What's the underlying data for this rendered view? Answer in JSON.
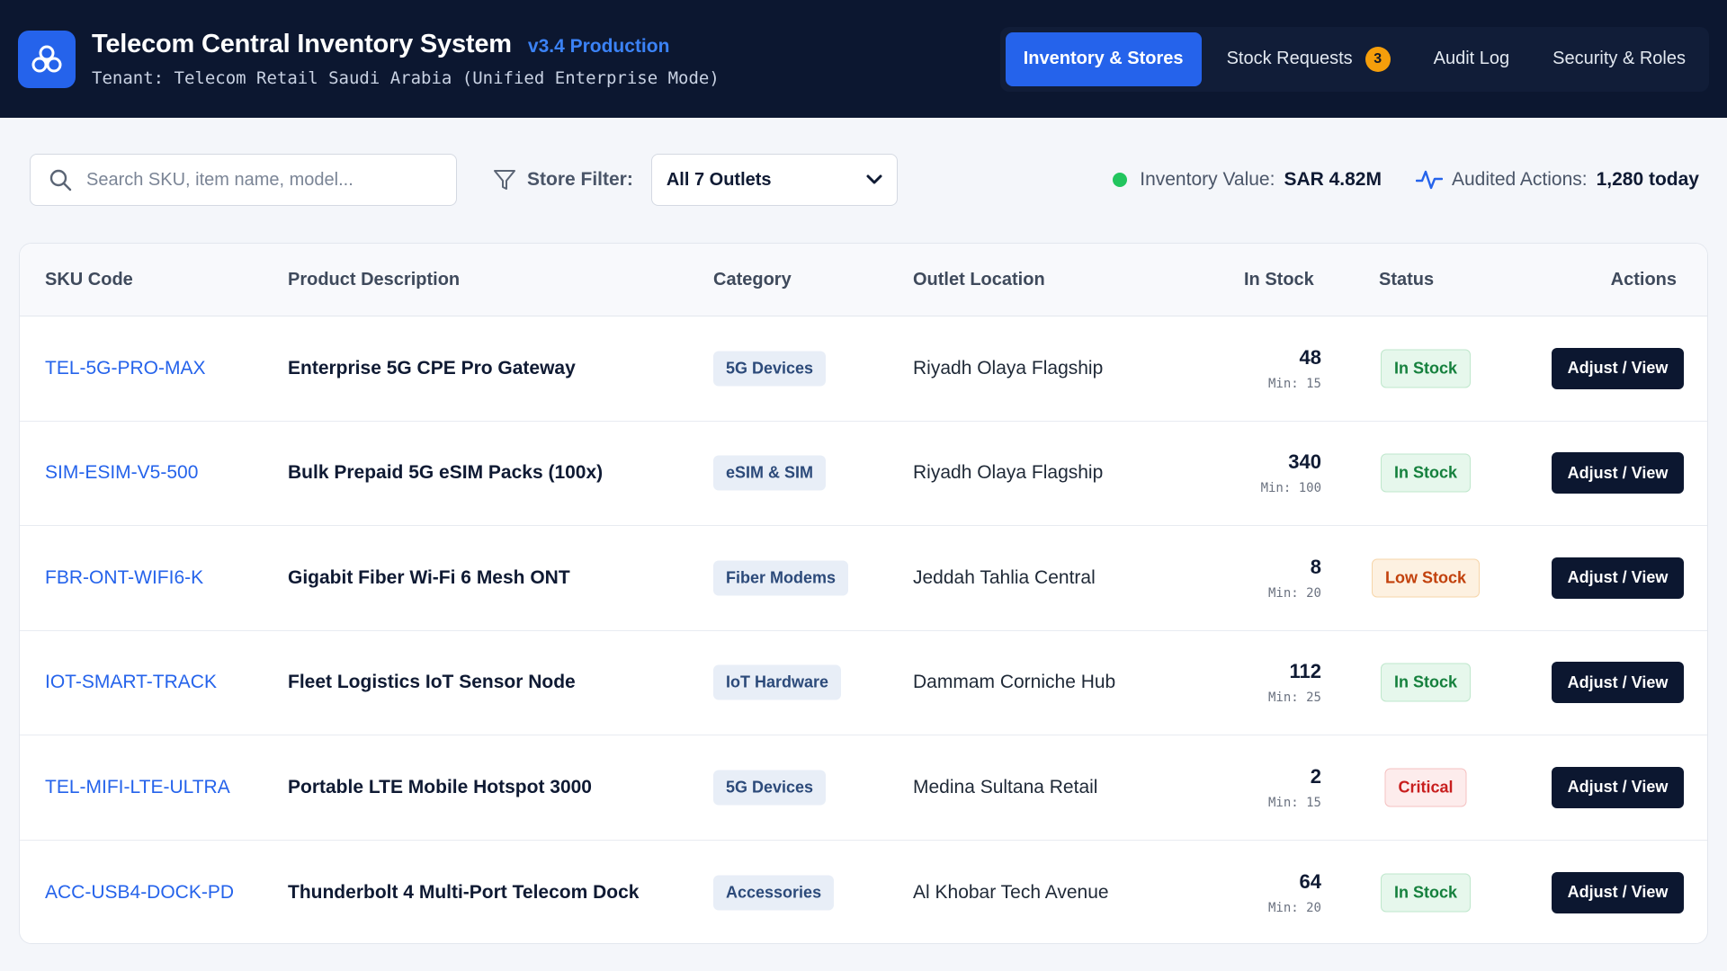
{
  "header": {
    "app_title": "Telecom Central Inventory System",
    "version": "v3.4 Production",
    "tenant": "Tenant: Telecom Retail Saudi Arabia (Unified Enterprise Mode)",
    "logo_icon": "biohazard-cluster-icon",
    "tabs": [
      {
        "label": "Inventory & Stores",
        "active": true
      },
      {
        "label": "Stock Requests",
        "badge": "3"
      },
      {
        "label": "Audit Log"
      },
      {
        "label": "Security & Roles"
      }
    ]
  },
  "toolbar": {
    "search_placeholder": "Search SKU, item name, model...",
    "filter_label": "Store Filter:",
    "store_selected": "All 7 Outlets",
    "inventory_value_label": "Inventory Value:",
    "inventory_value": "SAR 4.82M",
    "audited_label": "Audited Actions:",
    "audited_value": "1,280 today"
  },
  "table": {
    "columns": {
      "sku": "SKU Code",
      "description": "Product Description",
      "category": "Category",
      "outlet": "Outlet Location",
      "stock": "In Stock",
      "status": "Status",
      "actions": "Actions"
    },
    "action_label": "Adjust / View",
    "rows": [
      {
        "sku": "TEL-5G-PRO-MAX",
        "description": "Enterprise 5G CPE Pro Gateway",
        "category": "5G Devices",
        "outlet": "Riyadh Olaya Flagship",
        "stock": "48",
        "min": "Min: 15",
        "status": "In Stock"
      },
      {
        "sku": "SIM-ESIM-V5-500",
        "description": "Bulk Prepaid 5G eSIM Packs (100x)",
        "category": "eSIM & SIM",
        "outlet": "Riyadh Olaya Flagship",
        "stock": "340",
        "min": "Min: 100",
        "status": "In Stock"
      },
      {
        "sku": "FBR-ONT-WIFI6-K",
        "description": "Gigabit Fiber Wi-Fi 6 Mesh ONT",
        "category": "Fiber Modems",
        "outlet": "Jeddah Tahlia Central",
        "stock": "8",
        "min": "Min: 20",
        "status": "Low Stock"
      },
      {
        "sku": "IOT-SMART-TRACK",
        "description": "Fleet Logistics IoT Sensor Node",
        "category": "IoT Hardware",
        "outlet": "Dammam Corniche Hub",
        "stock": "112",
        "min": "Min: 25",
        "status": "In Stock"
      },
      {
        "sku": "TEL-MIFI-LTE-ULTRA",
        "description": "Portable LTE Mobile Hotspot 3000",
        "category": "5G Devices",
        "outlet": "Medina Sultana Retail",
        "stock": "2",
        "min": "Min: 15",
        "status": "Critical"
      },
      {
        "sku": "ACC-USB4-DOCK-PD",
        "description": "Thunderbolt 4 Multi-Port Telecom Dock",
        "category": "Accessories",
        "outlet": "Al Khobar Tech Avenue",
        "stock": "64",
        "min": "Min: 20",
        "status": "In Stock"
      }
    ]
  },
  "colors": {
    "header_bg": "#0c1730",
    "accent": "#2563eb",
    "badge": "#f59e0b",
    "in_stock": "#15803d",
    "low_stock": "#c2410c",
    "critical": "#c81e1e",
    "status_dot": "#22c55e"
  }
}
